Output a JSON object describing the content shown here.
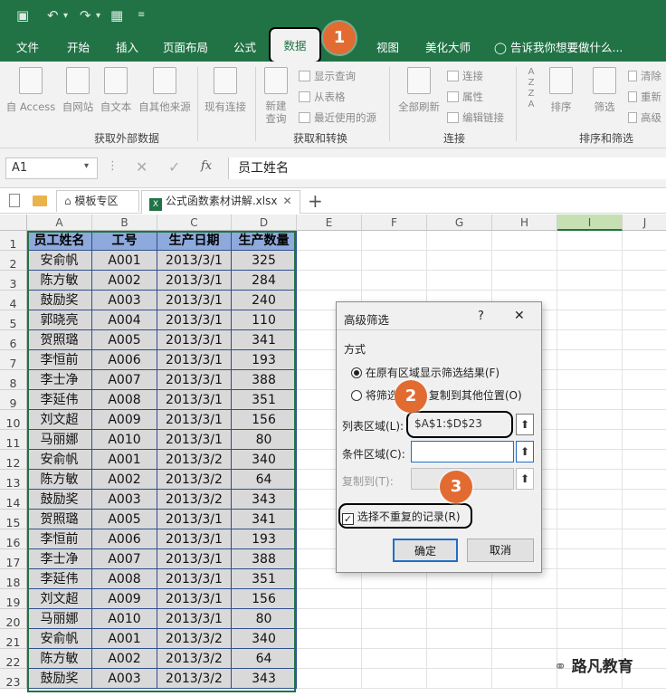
{
  "tabs": [
    "文件",
    "开始",
    "插入",
    "页面布局",
    "公式",
    "数据",
    "视图",
    "美化大师"
  ],
  "tell_me": "告诉我你想要做什么...",
  "ribbon": {
    "get_external": {
      "items": [
        "自 Access",
        "自网站",
        "自文本",
        "自其他来源",
        "现有连接"
      ],
      "label": "获取外部数据"
    },
    "get_transform": {
      "new_query": "新建\n查询",
      "show_query": "显示查询",
      "from_table": "从表格",
      "recent_sources": "最近使用的源",
      "label": "获取和转换"
    },
    "connections": {
      "refresh_all": "全部刷新",
      "connections": "连接",
      "properties": "属性",
      "edit_links": "编辑链接",
      "label": "连接"
    },
    "sort_filter": {
      "sort": "排序",
      "filter": "筛选",
      "clear": "清除",
      "reapply": "重新",
      "advanced": "高级",
      "label": "排序和筛选"
    }
  },
  "name_box": "A1",
  "formula": "员工姓名",
  "fx": "fx",
  "sheet_tabs": {
    "template": "模板专区",
    "file": "公式函数素材讲解.xlsx"
  },
  "columns": [
    "A",
    "B",
    "C",
    "D",
    "E",
    "F",
    "G",
    "H",
    "I",
    "J"
  ],
  "headers": [
    "员工姓名",
    "工号",
    "生产日期",
    "生产数量"
  ],
  "rows": [
    [
      "安俞帆",
      "A001",
      "2013/3/1",
      "325"
    ],
    [
      "陈方敏",
      "A002",
      "2013/3/1",
      "284"
    ],
    [
      "鼓励奖",
      "A003",
      "2013/3/1",
      "240"
    ],
    [
      "郭晓亮",
      "A004",
      "2013/3/1",
      "110"
    ],
    [
      "贺照璐",
      "A005",
      "2013/3/1",
      "341"
    ],
    [
      "李恒前",
      "A006",
      "2013/3/1",
      "193"
    ],
    [
      "李士净",
      "A007",
      "2013/3/1",
      "388"
    ],
    [
      "李延伟",
      "A008",
      "2013/3/1",
      "351"
    ],
    [
      "刘文超",
      "A009",
      "2013/3/1",
      "156"
    ],
    [
      "马丽娜",
      "A010",
      "2013/3/1",
      "80"
    ],
    [
      "安俞帆",
      "A001",
      "2013/3/2",
      "340"
    ],
    [
      "陈方敏",
      "A002",
      "2013/3/2",
      "64"
    ],
    [
      "鼓励奖",
      "A003",
      "2013/3/2",
      "343"
    ],
    [
      "贺照璐",
      "A005",
      "2013/3/1",
      "341"
    ],
    [
      "李恒前",
      "A006",
      "2013/3/1",
      "193"
    ],
    [
      "李士净",
      "A007",
      "2013/3/1",
      "388"
    ],
    [
      "李延伟",
      "A008",
      "2013/3/1",
      "351"
    ],
    [
      "刘文超",
      "A009",
      "2013/3/1",
      "156"
    ],
    [
      "马丽娜",
      "A010",
      "2013/3/1",
      "80"
    ],
    [
      "安俞帆",
      "A001",
      "2013/3/2",
      "340"
    ],
    [
      "陈方敏",
      "A002",
      "2013/3/2",
      "64"
    ],
    [
      "鼓励奖",
      "A003",
      "2013/3/2",
      "343"
    ]
  ],
  "row_numbers": [
    "1",
    "2",
    "3",
    "4",
    "5",
    "6",
    "7",
    "8",
    "9",
    "10",
    "11",
    "12",
    "13",
    "14",
    "15",
    "16",
    "17",
    "18",
    "19",
    "20",
    "21",
    "22",
    "23"
  ],
  "dialog": {
    "title": "高级筛选",
    "help": "?",
    "close": "✕",
    "mode_label": "方式",
    "option_inplace": "在原有区域显示筛选结果(F)",
    "option_copy_a": "将筛选",
    "option_copy_b": "复制到其他位置(O)",
    "list_range_label": "列表区域(L):",
    "list_range_value": "$A$1:$D$23",
    "criteria_label": "条件区域(C):",
    "copy_to_label": "复制到(T):",
    "unique_label": "选择不重复的记录(R)",
    "ok": "确定",
    "cancel": "取消"
  },
  "badges": [
    "1",
    "2",
    "3"
  ],
  "watermark": "路凡教育",
  "colors": {
    "excel_green": "#217346",
    "header_fill": "#8ea9db",
    "data_fill": "#d9d9d9",
    "badge": "#e26b32"
  }
}
